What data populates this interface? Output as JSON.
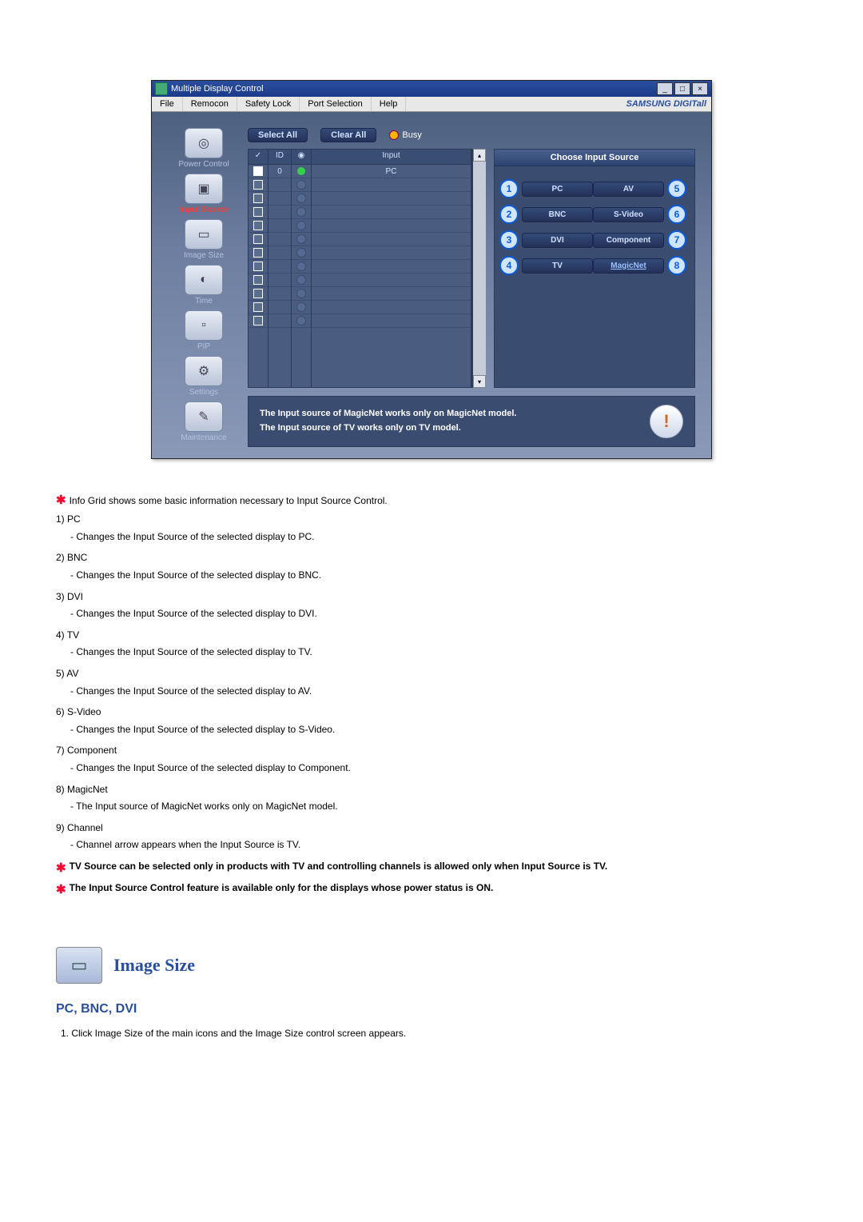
{
  "window": {
    "title": "Multiple Display Control",
    "menu": [
      "File",
      "Remocon",
      "Safety Lock",
      "Port Selection",
      "Help"
    ],
    "brand": "SAMSUNG DIGITall"
  },
  "sidebar": [
    {
      "label": "Power Control",
      "icon": "◎",
      "active": false
    },
    {
      "label": "Input Source",
      "icon": "▣",
      "active": true
    },
    {
      "label": "Image Size",
      "icon": "▭",
      "active": false
    },
    {
      "label": "Time",
      "icon": "◐",
      "active": false
    },
    {
      "label": "PIP",
      "icon": "▫",
      "active": false
    },
    {
      "label": "Settings",
      "icon": "⚙",
      "active": false
    },
    {
      "label": "Maintenance",
      "icon": "✎",
      "active": false
    }
  ],
  "toolbar": {
    "select_all": "Select All",
    "clear_all": "Clear All",
    "busy_label": "Busy"
  },
  "grid": {
    "headers": {
      "chk": "✓",
      "id": "ID",
      "dot": "◉",
      "input": "Input"
    },
    "rows": [
      {
        "checked": true,
        "id": "0",
        "status": "green",
        "input": "PC"
      },
      {
        "checked": false,
        "id": "",
        "status": "off",
        "input": ""
      },
      {
        "checked": false,
        "id": "",
        "status": "off",
        "input": ""
      },
      {
        "checked": false,
        "id": "",
        "status": "off",
        "input": ""
      },
      {
        "checked": false,
        "id": "",
        "status": "off",
        "input": ""
      },
      {
        "checked": false,
        "id": "",
        "status": "off",
        "input": ""
      },
      {
        "checked": false,
        "id": "",
        "status": "off",
        "input": ""
      },
      {
        "checked": false,
        "id": "",
        "status": "off",
        "input": ""
      },
      {
        "checked": false,
        "id": "",
        "status": "off",
        "input": ""
      },
      {
        "checked": false,
        "id": "",
        "status": "off",
        "input": ""
      },
      {
        "checked": false,
        "id": "",
        "status": "off",
        "input": ""
      },
      {
        "checked": false,
        "id": "",
        "status": "off",
        "input": ""
      }
    ]
  },
  "panel": {
    "title": "Choose Input Source",
    "left": [
      {
        "n": "1",
        "label": "PC"
      },
      {
        "n": "2",
        "label": "BNC"
      },
      {
        "n": "3",
        "label": "DVI"
      },
      {
        "n": "4",
        "label": "TV"
      }
    ],
    "right": [
      {
        "n": "5",
        "label": "AV"
      },
      {
        "n": "6",
        "label": "S-Video"
      },
      {
        "n": "7",
        "label": "Component"
      },
      {
        "n": "8",
        "label": "MagicNet",
        "magic": true
      }
    ]
  },
  "footer": {
    "line1": "The Input source of MagicNet works only on MagicNet model.",
    "line2": "The Input source of TV works only on TV  model."
  },
  "doc": {
    "intro": "Info Grid shows some basic information necessary to Input Source Control.",
    "items": [
      {
        "n": "1)",
        "t": "PC",
        "d": "- Changes the Input Source of the selected display to PC."
      },
      {
        "n": "2)",
        "t": "BNC",
        "d": "- Changes the Input Source of the selected display to BNC."
      },
      {
        "n": "3)",
        "t": "DVI",
        "d": "- Changes the Input Source of the selected display to DVI."
      },
      {
        "n": "4)",
        "t": "TV",
        "d": "- Changes the Input Source of the selected display to TV."
      },
      {
        "n": "5)",
        "t": "AV",
        "d": "- Changes the Input Source of the selected display to AV."
      },
      {
        "n": "6)",
        "t": "S-Video",
        "d": "- Changes the Input Source of the selected display to S-Video."
      },
      {
        "n": "7)",
        "t": "Component",
        "d": "- Changes the Input Source of the selected display to Component."
      },
      {
        "n": "8)",
        "t": "MagicNet",
        "d": "- The Input source of MagicNet works only on MagicNet model."
      },
      {
        "n": "9)",
        "t": "Channel",
        "d": "- Channel arrow appears when the Input Source is TV."
      }
    ],
    "note1": "TV Source can be selected only in products with TV and controlling channels is allowed only when Input Source is TV.",
    "note2": "The Input Source Control feature is available only for the displays whose power status is ON.",
    "section_title": "Image Size",
    "sub_title": "PC, BNC, DVI",
    "step1": "1.  Click Image Size of the main icons and the Image Size control screen appears."
  }
}
